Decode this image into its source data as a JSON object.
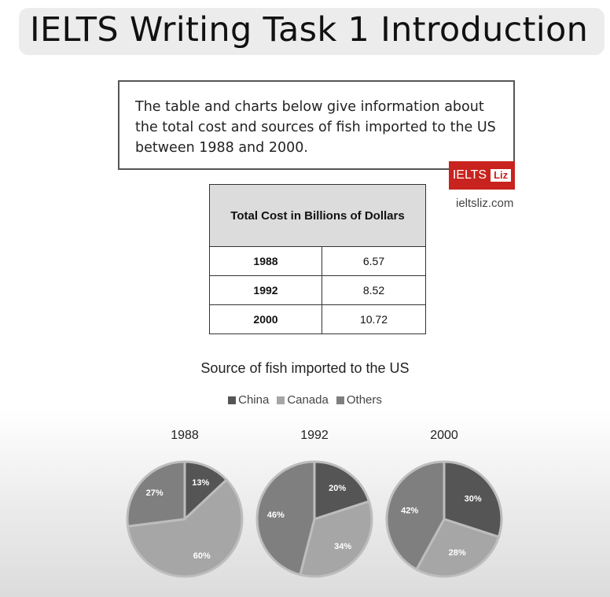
{
  "header": {
    "title": "IELTS Writing Task 1 Introduction"
  },
  "prompt": {
    "text": "The table and charts below give information about the total cost and sources of fish imported to the US between 1988 and 2000."
  },
  "brand": {
    "name": "IELTS",
    "tag": "Liz",
    "url": "ieltsliz.com",
    "color": "#c8231e"
  },
  "table": {
    "header": "Total Cost in Billions of Dollars",
    "rows": [
      {
        "year": "1988",
        "value": "6.57"
      },
      {
        "year": "1992",
        "value": "8.52"
      },
      {
        "year": "2000",
        "value": "10.72"
      }
    ]
  },
  "chart_data": {
    "type": "pie",
    "title": "Source of fish imported to the US",
    "legend": [
      "China",
      "Canada",
      "Others"
    ],
    "legend_placement": "top",
    "colors": {
      "China": "#555555",
      "Canada": "#a6a6a6",
      "Others": "#7f7f7f"
    },
    "charts": [
      {
        "label": "1988",
        "values": {
          "China": 13,
          "Canada": 60,
          "Others": 27
        }
      },
      {
        "label": "1992",
        "values": {
          "China": 20,
          "Canada": 34,
          "Others": 46
        }
      },
      {
        "label": "2000",
        "values": {
          "China": 30,
          "Canada": 28,
          "Others": 42
        }
      }
    ],
    "value_format": "percent"
  }
}
